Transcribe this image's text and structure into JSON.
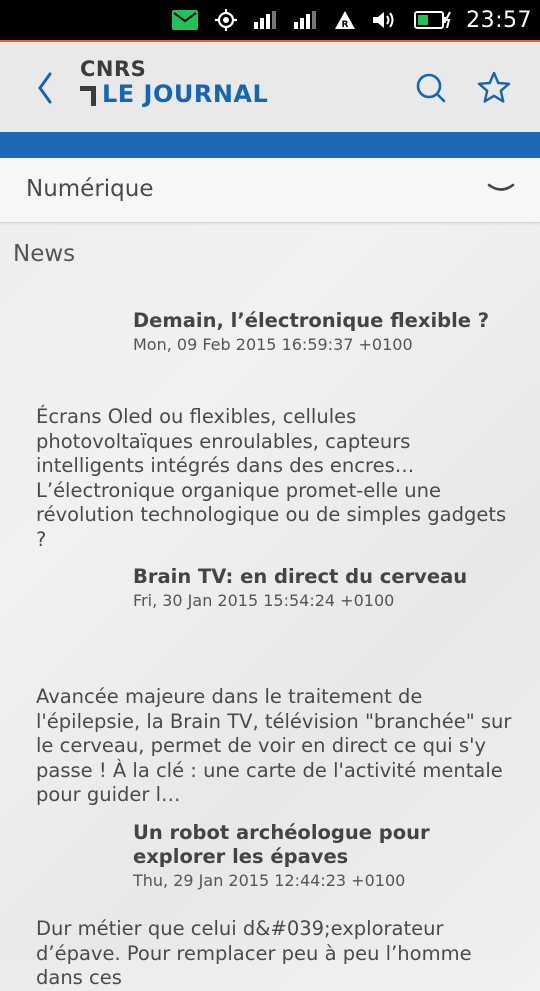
{
  "status_bar": {
    "time": "23:57",
    "icons": [
      "message-icon",
      "location-icon",
      "signal-icon",
      "signal-icon",
      "roaming-icon",
      "volume-icon",
      "battery-charging-icon"
    ]
  },
  "header": {
    "logo_line1": "CNRS",
    "logo_line2": "LE JOURNAL",
    "icons": [
      "back-icon",
      "search-icon",
      "star-icon"
    ]
  },
  "colors": {
    "brand_blue": "#1c6ab3",
    "accent_orange": "#e2643b",
    "status_green": "#22c25a"
  },
  "category": {
    "selected": "Numérique"
  },
  "section_title": "News",
  "articles": [
    {
      "title": "Demain, l’électronique flexible ?",
      "date": "Mon, 09 Feb 2015 16:59:37 +0100",
      "description": "Écrans Oled ou flexibles, cellules photovoltaïques enroulables, capteurs intelligents intégrés dans des encres… L’électronique organique promet-elle une révolution technologique ou de simples gadgets ?"
    },
    {
      "title": "Brain TV: en direct du cerveau",
      "date": "Fri, 30 Jan 2015 15:54:24 +0100",
      "description": "Avancée majeure dans le traitement de l'épilepsie, la Brain TV, télévision \"branchée\" sur le cerveau, permet de voir en direct ce qui s'y passe ! À la clé : une carte de l'activité mentale pour guider l…"
    },
    {
      "title": "Un robot archéologue pour explorer les épaves",
      "date": "Thu, 29 Jan 2015 12:44:23 +0100",
      "description": "Dur métier que celui d&#039;explorateur d’épave. Pour remplacer peu à peu l’homme dans ces"
    }
  ]
}
